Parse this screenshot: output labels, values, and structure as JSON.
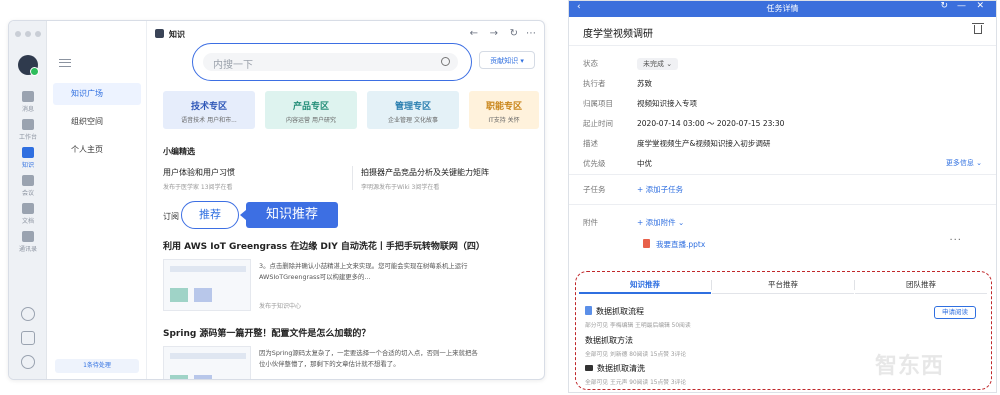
{
  "left_app": {
    "window_title": "知识",
    "rail": [
      {
        "label": "消息"
      },
      {
        "label": "工作台"
      },
      {
        "label": "知识"
      },
      {
        "label": "会议"
      },
      {
        "label": "文档"
      },
      {
        "label": "通讯录"
      }
    ],
    "nav": {
      "items": [
        "知识广场",
        "组织空间",
        "个人主页"
      ],
      "footer": "1条待处理"
    },
    "search": {
      "placeholder": "内搜一下"
    },
    "contribute_label": "贡献知识",
    "zones": [
      {
        "title": "技术专区",
        "subtitle": "语音技术  用户和市...",
        "bg": "#e6edfb",
        "color": "#2f57b8"
      },
      {
        "title": "产品专区",
        "subtitle": "内容运营  用户研究",
        "bg": "#def3ef",
        "color": "#258f79"
      },
      {
        "title": "管理专区",
        "subtitle": "企业管理  文化故事",
        "bg": "#e4f1f7",
        "color": "#2b7fb0"
      },
      {
        "title": "职能专区",
        "subtitle": "IT支持  关怀",
        "bg": "#fff2dc",
        "color": "#c98519"
      }
    ],
    "picks_title": "小编精选",
    "picks": [
      {
        "title": "用户体验和用户习惯",
        "meta": "发布于医学家  13阅学在看"
      },
      {
        "title": "拍摄器产品竞品分析及关键能力矩阵",
        "meta": "李明源发布于Wiki  3阅学在看"
      }
    ],
    "tabs": {
      "subscribe": "订阅",
      "recommend": "推荐"
    },
    "callout": "知识推荐",
    "articles": [
      {
        "title": "利用 AWS IoT Greengrass 在边缘 DIY 自动洗花丨手把手玩转物联网（四）",
        "desc": "3。点击删除并确认小喆精湛上文来实现。您可能会实现在树莓系机上运行AWSIoTGreengrass可以构建更多的...",
        "source": "发布于知识中心"
      },
      {
        "title": "Spring 源码第一篇开整！配置文件是怎么加载的？",
        "desc": "因为Spring源码太复杂了，一定要选择一个合适的切入点，否则一上来就把各位小伙伴整懵了，那剩下的文章估计就不想看了。",
        "source": ""
      }
    ]
  },
  "task_panel": {
    "header_title": "任务详情",
    "task_title": "度学堂视频调研",
    "fields": [
      {
        "label": "状态",
        "value": "未完成"
      },
      {
        "label": "执行者",
        "value": "苏致"
      },
      {
        "label": "归属项目",
        "value": "视频知识接入专项"
      },
      {
        "label": "起止时间",
        "value": "2020-07-14 03:00 ～ 2020-07-15 23:30"
      },
      {
        "label": "描述",
        "value": "度学堂视频生产&视频知识接入初步调研"
      },
      {
        "label": "优先级",
        "value": "中优"
      }
    ],
    "more_info": "更多信息",
    "subtask": {
      "label": "子任务",
      "add": "+ 添加子任务"
    },
    "attachment": {
      "label": "附件",
      "add": "+ 添加附件",
      "file": "我要直播.pptx"
    },
    "rec_tabs": [
      "知识推荐",
      "平台推荐",
      "团队推荐"
    ],
    "rec_items": [
      {
        "title": "数据抓取流程",
        "meta": "部分可见   李梅编辑   王明最后编辑   50阅读",
        "icon": "doc"
      },
      {
        "title": "数据抓取方法",
        "meta": "全部可见   刘新德   80阅读   15点赞   3评论",
        "icon": "none"
      },
      {
        "title": "数据抓取清洗",
        "meta": "全部可见   王元声   90阅读   15点赞   3评论",
        "icon": "video"
      }
    ],
    "read_button": "申请阅读"
  },
  "watermark": "智东西"
}
